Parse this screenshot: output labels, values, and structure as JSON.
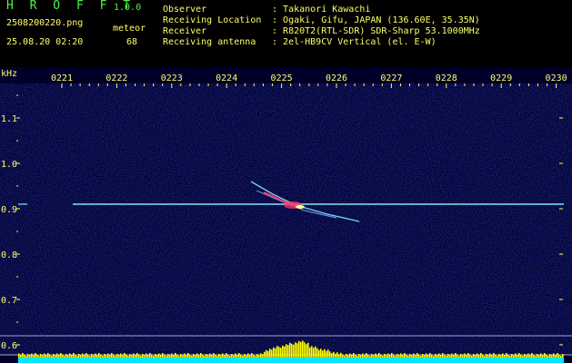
{
  "app": {
    "title": "H R O F F T",
    "version": "1.0.0"
  },
  "file": {
    "name": "2508200220.png",
    "timestamp": "25.08.20 02:20"
  },
  "detection": {
    "type": "meteor",
    "count": "68"
  },
  "info": [
    {
      "label": "Observer",
      "value": "Takanori Kawachi"
    },
    {
      "label": "Receiving Location",
      "value": "Ogaki, Gifu, JAPAN (136.60E, 35.35N)"
    },
    {
      "label": "Receiver",
      "value": "R820T2(RTL-SDR) SDR-Sharp 53.1000MHz"
    },
    {
      "label": "Receiving antenna",
      "value": "2el-HB9CV Vertical (el. E-W)"
    }
  ],
  "axis": {
    "y_unit": "kHz",
    "y_ticks": [
      "1.1",
      "1.0",
      "0.9",
      "0.8",
      "0.7",
      "0.6"
    ],
    "x_ticks": [
      "0221",
      "0222",
      "0223",
      "0224",
      "0225",
      "0226",
      "0227",
      "0228",
      "0229",
      "0230"
    ]
  },
  "colors": {
    "background": "#00002a",
    "label_text": "#ffff66",
    "title_text": "#4ff24a",
    "carrier": "#7fe6f5",
    "echo": "#ff3a6e",
    "level_bar": "#ffff00",
    "level_base": "#00e8ff"
  }
}
